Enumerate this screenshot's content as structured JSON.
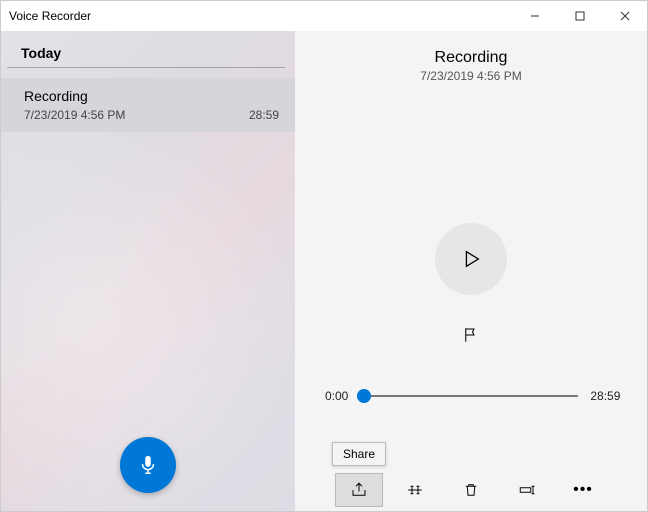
{
  "app_title": "Voice Recorder",
  "sidebar": {
    "section_label": "Today",
    "items": [
      {
        "title": "Recording",
        "datetime": "7/23/2019 4:56 PM",
        "duration": "28:59"
      }
    ]
  },
  "detail": {
    "title": "Recording",
    "datetime": "7/23/2019 4:56 PM",
    "current_time": "0:00",
    "total_time": "28:59"
  },
  "bottombar": {
    "share_tooltip": "Share"
  }
}
